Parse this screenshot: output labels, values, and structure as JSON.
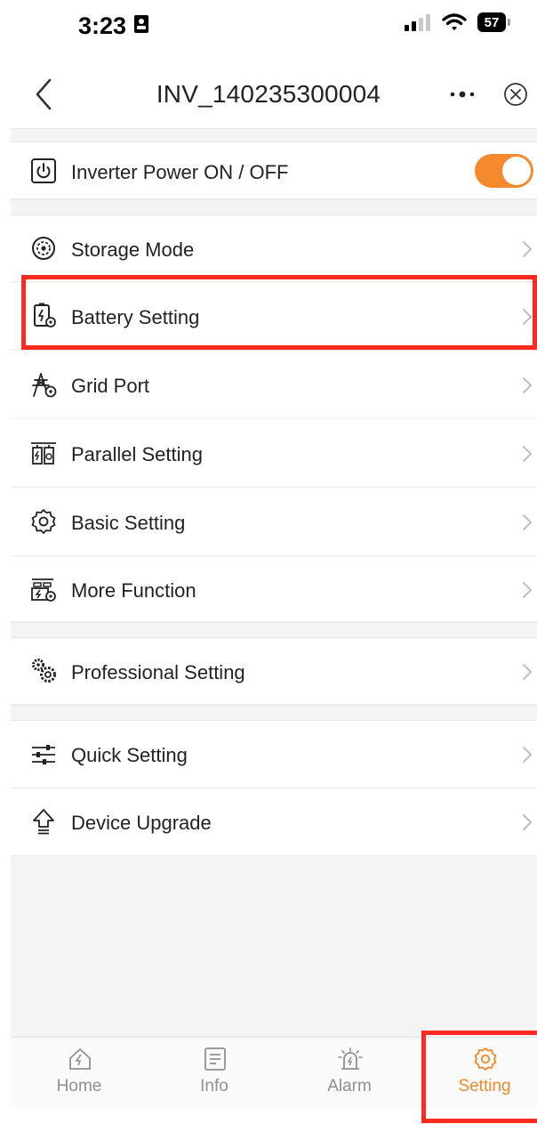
{
  "status_bar": {
    "time": "3:23",
    "battery_level": "57"
  },
  "nav": {
    "title": "INV_140235300004"
  },
  "power": {
    "label": "Inverter Power ON / OFF",
    "state": "on"
  },
  "menu": [
    {
      "label": "Storage Mode",
      "icon": "storage-mode-icon"
    },
    {
      "label": "Battery Setting",
      "icon": "battery-setting-icon"
    },
    {
      "label": "Grid Port",
      "icon": "grid-port-icon"
    },
    {
      "label": "Parallel Setting",
      "icon": "parallel-setting-icon"
    },
    {
      "label": "Basic Setting",
      "icon": "gear-icon"
    },
    {
      "label": "More Function",
      "icon": "more-function-icon"
    },
    {
      "label": "Professional Setting",
      "icon": "professional-setting-icon"
    },
    {
      "label": "Quick Setting",
      "icon": "sliders-icon"
    },
    {
      "label": "Device Upgrade",
      "icon": "upgrade-icon"
    }
  ],
  "tabs": [
    {
      "label": "Home",
      "icon": "home-icon"
    },
    {
      "label": "Info",
      "icon": "info-icon"
    },
    {
      "label": "Alarm",
      "icon": "alarm-icon"
    },
    {
      "label": "Setting",
      "icon": "gear-icon"
    }
  ],
  "colors": {
    "accent": "#f5892d",
    "highlight": "#ff2a1f",
    "tab_inactive": "#8f8f94"
  }
}
